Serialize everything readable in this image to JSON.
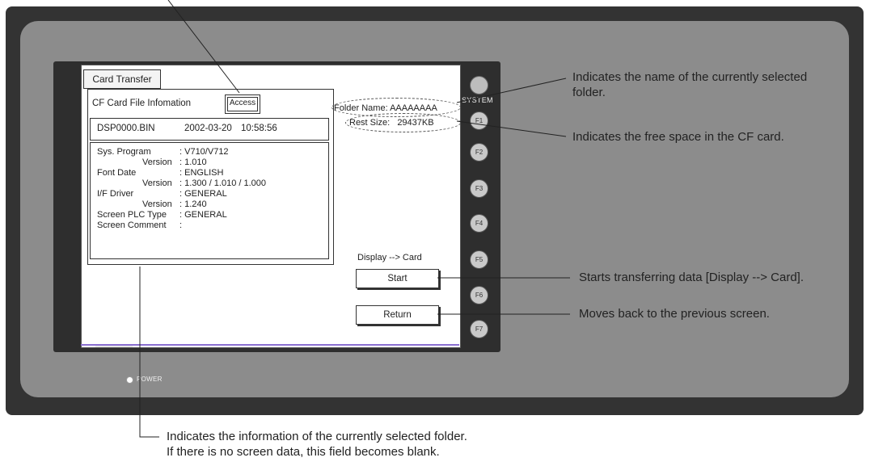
{
  "screen": {
    "tab_label": "Card Transfer",
    "panel_title": "CF Card File Infomation",
    "access_button": "Access",
    "file": {
      "name": "DSP0000.BIN",
      "date": "2002-03-20",
      "time": "10:58:56"
    },
    "details": {
      "sys_program_label": "Sys.  Program",
      "sys_program_value": ": V710/V712",
      "sys_version_label": "Version",
      "sys_version_value": ": 1.010",
      "font_label": "Font Date",
      "font_value": ": ENGLISH",
      "font_version_label": "Version",
      "font_version_value": ": 1.300 / 1.010 / 1.000",
      "if_driver_label": "I/F Driver",
      "if_driver_value": ": GENERAL",
      "if_version_label": "Version",
      "if_version_value": ": 1.240",
      "plc_type_label": "Screen PLC Type",
      "plc_type_value": ": GENERAL",
      "comment_label": "Screen Comment",
      "comment_value": ":"
    },
    "folder_name": "Folder Name: AAAAAAAA",
    "rest_size_label": "Rest Size:",
    "rest_size_value": "29437KB",
    "transfer_direction": "Display --> Card",
    "start_button": "Start",
    "return_button": "Return"
  },
  "device": {
    "system_label": "SYSTEM",
    "function_keys": [
      "F1",
      "F2",
      "F3",
      "F4",
      "F5",
      "F6",
      "F7"
    ],
    "power_label": "POWER"
  },
  "callouts": {
    "folder_name_line1": "Indicates the name of the currently selected",
    "folder_name_line2": "folder.",
    "free_space": "Indicates the free space in the CF card.",
    "start": "Starts transferring data [Display --> Card].",
    "return": "Moves back to the previous screen.",
    "info_line1": "Indicates the information of the currently selected folder.",
    "info_line2": "If there is no screen data, this field becomes blank."
  },
  "colors": {
    "housing_dark": "#333333",
    "housing_gray": "#8c8c8c",
    "lcd_bg": "#ffffff",
    "key_gray": "#c9c9c9"
  }
}
